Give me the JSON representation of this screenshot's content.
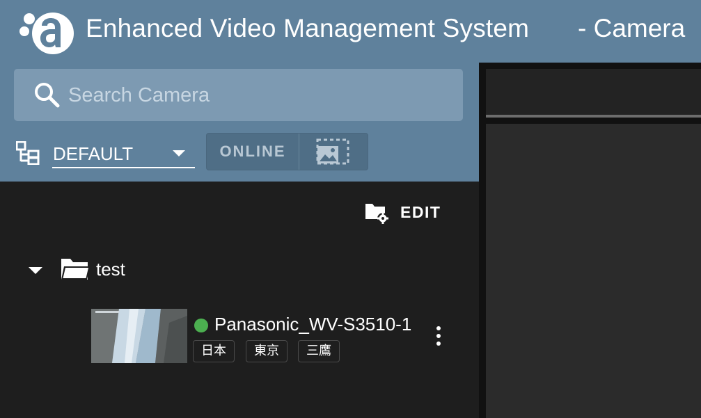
{
  "header": {
    "app_title": "Enhanced Video Management System",
    "page_title": "- Camera"
  },
  "search": {
    "placeholder": "Search Camera",
    "value": ""
  },
  "group_selector": {
    "selected": "DEFAULT"
  },
  "filter_toggle": {
    "online_label": "ONLINE"
  },
  "list": {
    "edit_label": "EDIT",
    "folder": {
      "name": "test",
      "expanded": true
    },
    "cameras": [
      {
        "name": "Panasonic_WV-S3510-1",
        "status": "online",
        "status_color": "#4caf50",
        "tags": [
          "日本",
          "東京",
          "三鷹"
        ]
      }
    ]
  },
  "colors": {
    "header_bg": "#5f819c",
    "search_bg": "#7d9ab2",
    "list_bg": "#1e1e1e",
    "online_status": "#4caf50"
  },
  "icons": {
    "logo": "brand-logo-icon",
    "search": "search-icon",
    "tree": "tree-view-icon",
    "thumbnail_toggle": "thumbnail-view-icon",
    "edit": "folder-settings-icon",
    "folder": "folder-open-icon",
    "more": "more-vert-icon"
  }
}
